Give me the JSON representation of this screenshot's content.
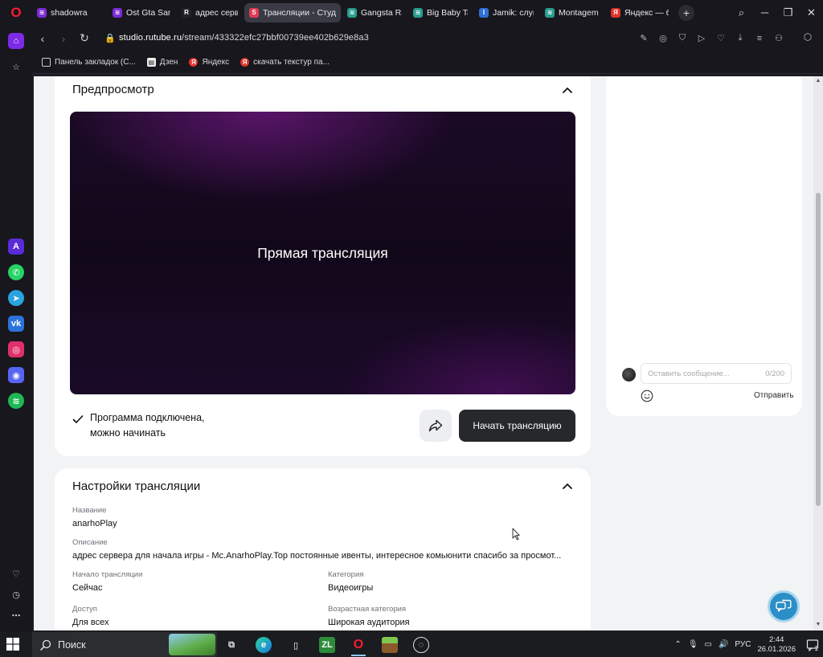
{
  "browser": {
    "tabs": [
      {
        "title": "shadowra",
        "color": "#7b2bd6",
        "glyph": "≋"
      },
      {
        "title": "Ost Gta San A",
        "color": "#7b2bd6",
        "glyph": "≋"
      },
      {
        "title": "адрес сервер",
        "color": "#222228",
        "glyph": "R"
      },
      {
        "title": "Трансляции - Студия",
        "color": "#e23a55",
        "glyph": "S"
      },
      {
        "title": "Gangsta Rap",
        "color": "#2a9d8f",
        "glyph": "≋"
      },
      {
        "title": "Big Baby Tape",
        "color": "#2a9d8f",
        "glyph": "≋"
      },
      {
        "title": "Jamik: слушат",
        "color": "#2f6fd6",
        "glyph": "I"
      },
      {
        "title": "Montagem La",
        "color": "#2a9d8f",
        "glyph": "≋"
      },
      {
        "title": "Яндекс — бы",
        "color": "#e0322b",
        "glyph": "Я"
      }
    ],
    "url_host": "studio.rutube.ru",
    "url_path": "/stream/433322efc27bbf00739ee402b629e8a3",
    "bookmarks": [
      {
        "label": "Панель закладок (С...",
        "icon": "folder-icon"
      },
      {
        "label": "Дзен",
        "icon": "file-icon"
      },
      {
        "label": "Яндекс",
        "icon": "yandex-icon"
      },
      {
        "label": "скачать текстур па...",
        "icon": "yandex-icon"
      }
    ]
  },
  "preview": {
    "title": "Предпросмотр",
    "video_label": "Прямая трансляция",
    "status_line1": "Программа подключена,",
    "status_line2": "можно начинать",
    "start_button": "Начать трансляцию"
  },
  "settings": {
    "title": "Настройки трансляции",
    "name_label": "Название",
    "name_value": "anarhoPlay",
    "description_label": "Описание",
    "description_value": "адрес сервера для начала игры - Mc.AnarhoPlay.Top постоянные ивенты, интересное комьюнити спасибо за просмот...",
    "start_label": "Начало трансляции",
    "start_value": "Сейчас",
    "category_label": "Категория",
    "category_value": "Видеоигры",
    "access_label": "Доступ",
    "access_value": "Для всех",
    "age_label": "Возрастная категория",
    "age_value": "Широкая аудитория"
  },
  "chat": {
    "placeholder": "Оставить сообщение...",
    "counter": "0/200",
    "send": "Отправить"
  },
  "taskbar": {
    "search_placeholder": "Поиск",
    "language": "РУС",
    "time": "2:44",
    "date": "26.01.2026",
    "notifications": "1"
  },
  "colors": {
    "accent_dark": "#26282c",
    "browser_bg": "#17171d",
    "page_bg": "#f2f3f5"
  }
}
